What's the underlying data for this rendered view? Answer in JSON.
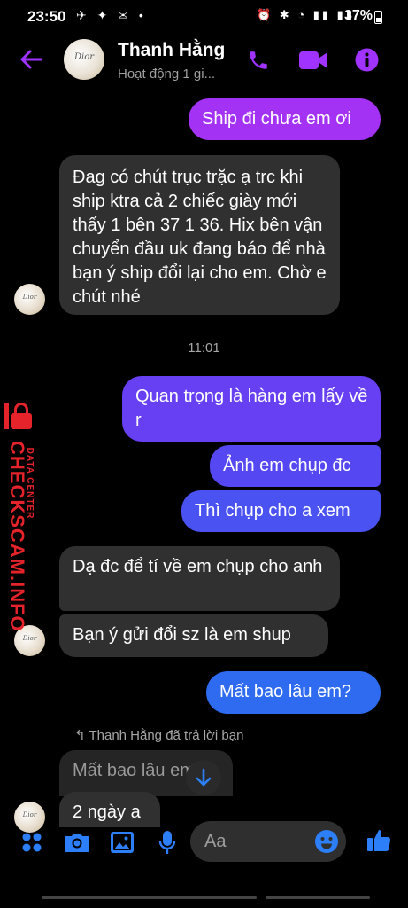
{
  "status_bar": {
    "time": "23:50",
    "left_icons": "✈ ✦ ✉ •",
    "right_icons": "⏰ ✱ ◔ ▮▮ ▮▮",
    "battery": "37%"
  },
  "header": {
    "contact_name": "Thanh Hằng",
    "contact_status": "Hoạt động 1 gi...",
    "avatar_text": "Dior"
  },
  "messages": [
    {
      "direction": "out",
      "text": "Ship đi chưa em ơi"
    },
    {
      "direction": "in",
      "text": "Đag có chút trục trặc ạ  trc khi ship ktra cả 2 chiếc giày mới thấy 1 bên 37 1 36. Hix bên vận chuyển đầu uk đang báo để nhà bạn ý ship đổi lại cho em. Chờ e chút nhé"
    },
    {
      "direction": "out",
      "text": "Quan trọng là hàng em lấy về r"
    },
    {
      "direction": "out",
      "text": "Ảnh em chụp đc"
    },
    {
      "direction": "out",
      "text": "Thì chụp cho a xem"
    },
    {
      "direction": "in",
      "text": "Dạ đc để tí về em chụp cho anh"
    },
    {
      "direction": "in",
      "text": "Bạn ý gửi đổi sz là em shup"
    },
    {
      "direction": "out",
      "text": "Mất bao lâu em?"
    },
    {
      "direction": "in",
      "text": "Mất bao lâu em?"
    },
    {
      "direction": "in",
      "text": "2 ngày a"
    }
  ],
  "time_separator": "11:01",
  "reply_note": "Thanh Hằng đã trả lời bạn",
  "watermark": {
    "brand": "CHECKSCAM.INFO",
    "sub": "DATA CENTER"
  },
  "composer": {
    "placeholder": "Aa"
  },
  "colors": {
    "accent": "#a033ff",
    "incoming_bubble": "#303030",
    "outgoing_top": "#a832f2",
    "outgoing_bottom": "#2f6bf0",
    "composer_icon": "#2d7ff9",
    "watermark": "#e5232a"
  }
}
